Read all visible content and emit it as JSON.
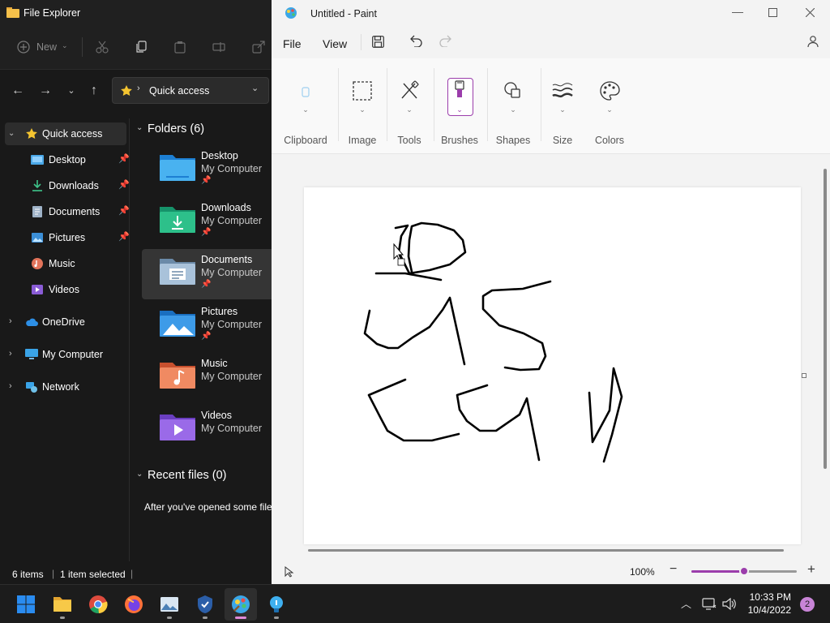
{
  "explorer": {
    "title": "File Explorer",
    "toolbar": {
      "new_label": "New"
    },
    "address": {
      "location": "Quick access"
    },
    "nav": {
      "quick_access": "Quick access",
      "items": [
        {
          "label": "Desktop",
          "pinned": true
        },
        {
          "label": "Downloads",
          "pinned": true
        },
        {
          "label": "Documents",
          "pinned": true
        },
        {
          "label": "Pictures",
          "pinned": true
        },
        {
          "label": "Music",
          "pinned": false
        },
        {
          "label": "Videos",
          "pinned": false
        }
      ],
      "onedrive": "OneDrive",
      "my_computer": "My Computer",
      "network": "Network"
    },
    "content": {
      "folders_header": "Folders (6)",
      "folders": [
        {
          "name": "Desktop",
          "location": "My Computer"
        },
        {
          "name": "Downloads",
          "location": "My Computer"
        },
        {
          "name": "Documents",
          "location": "My Computer"
        },
        {
          "name": "Pictures",
          "location": "My Computer"
        },
        {
          "name": "Music",
          "location": "My Computer"
        },
        {
          "name": "Videos",
          "location": "My Computer"
        }
      ],
      "recent_header": "Recent files (0)",
      "recent_empty": "After you've opened some file"
    },
    "status": {
      "items": "6 items",
      "selected": "1 item selected"
    }
  },
  "paint": {
    "title": "Untitled - Paint",
    "menu": {
      "file": "File",
      "view": "View"
    },
    "ribbon": {
      "clipboard": "Clipboard",
      "image": "Image",
      "tools": "Tools",
      "brushes": "Brushes",
      "shapes": "Shapes",
      "size": "Size",
      "colors": "Colors"
    },
    "zoom": "100%",
    "zoom_level": 0.5
  },
  "taskbar": {
    "time": "10:33 PM",
    "date": "10/4/2022",
    "notifications": "2"
  },
  "colors": {
    "accent": "#9b3dab",
    "explorer_bg": "#191919",
    "paint_bg": "#f3f3f3",
    "taskbar_bg": "#1c1c1c"
  }
}
